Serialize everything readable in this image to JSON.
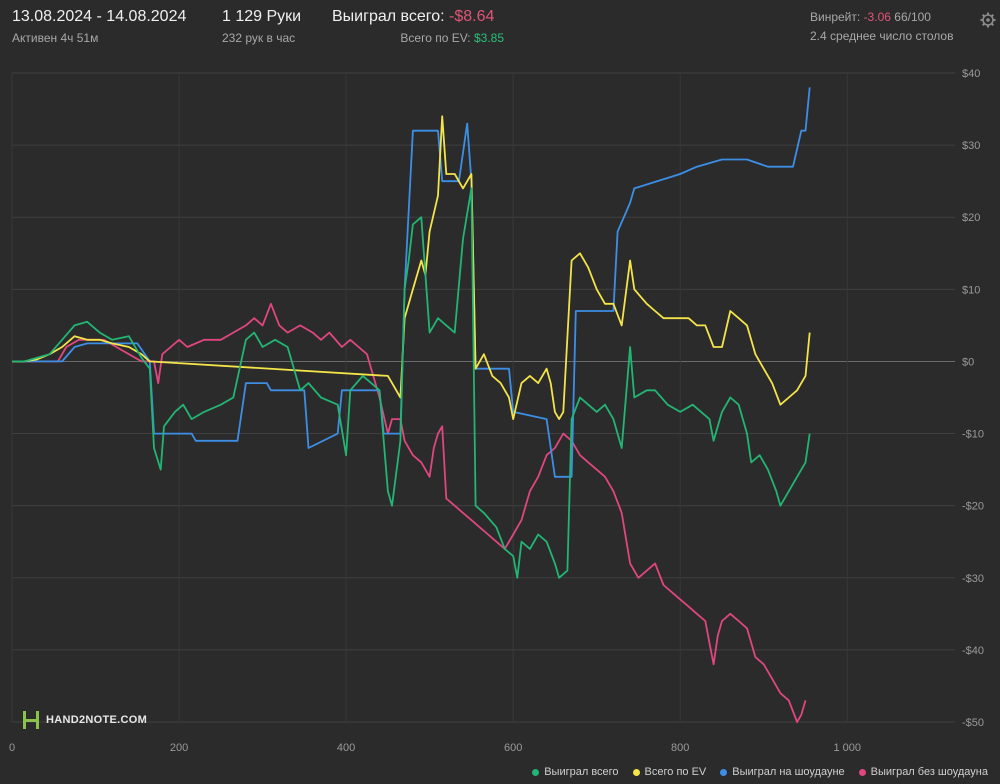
{
  "header": {
    "date_range": "13.08.2024 - 14.08.2024",
    "active": "Активен 4ч 51м",
    "hands": "1 129 Руки",
    "hands_per_hour": "232 рук в час",
    "won_total_label": "Выиграл всего:",
    "won_total_value": "-$8.64",
    "ev_label": "Всего по EV:",
    "ev_value": "$3.85",
    "winrate_label": "Винрейт:",
    "winrate_value": "-3.06",
    "winrate_suffix": "66/100",
    "avg_tables": "2.4 среднее число столов"
  },
  "logo": {
    "text": "HAND2NOTE.COM"
  },
  "colors": {
    "background": "#2b2b2b",
    "grid": "#3f3f3f",
    "green": "#22b573",
    "yellow": "#f4e44a",
    "blue": "#3d8fe6",
    "pink": "#e0467f"
  },
  "chart_data": {
    "type": "line",
    "xlim": [
      0,
      1129
    ],
    "ylim": [
      -50,
      40
    ],
    "x_ticks": [
      {
        "value": 0,
        "label": "0"
      },
      {
        "value": 200,
        "label": "200"
      },
      {
        "value": 400,
        "label": "400"
      },
      {
        "value": 600,
        "label": "600"
      },
      {
        "value": 800,
        "label": "800"
      },
      {
        "value": 1000,
        "label": "1 000"
      }
    ],
    "y_ticks": [
      {
        "value": 40,
        "label": "$40"
      },
      {
        "value": 30,
        "label": "$30"
      },
      {
        "value": 20,
        "label": "$20"
      },
      {
        "value": 10,
        "label": "$10"
      },
      {
        "value": 0,
        "label": "$0"
      },
      {
        "value": -10,
        "label": "-$10"
      },
      {
        "value": -20,
        "label": "-$20"
      },
      {
        "value": -30,
        "label": "-$30"
      },
      {
        "value": -40,
        "label": "-$40"
      },
      {
        "value": -50,
        "label": "-$50"
      }
    ],
    "grid": true,
    "legend_position": "bottom-right",
    "series": [
      {
        "name": "Выиграл всего",
        "color": "#22b573",
        "points": [
          [
            0,
            0
          ],
          [
            15,
            0
          ],
          [
            30,
            0.5
          ],
          [
            45,
            1
          ],
          [
            60,
            3
          ],
          [
            75,
            5
          ],
          [
            90,
            5.5
          ],
          [
            105,
            4
          ],
          [
            120,
            3
          ],
          [
            140,
            3.5
          ],
          [
            155,
            0.5
          ],
          [
            165,
            -1
          ],
          [
            170,
            -12
          ],
          [
            178,
            -15
          ],
          [
            182,
            -9
          ],
          [
            195,
            -7
          ],
          [
            205,
            -6
          ],
          [
            215,
            -8
          ],
          [
            230,
            -7
          ],
          [
            250,
            -6
          ],
          [
            265,
            -5
          ],
          [
            280,
            3
          ],
          [
            290,
            4
          ],
          [
            300,
            2
          ],
          [
            315,
            3
          ],
          [
            330,
            2
          ],
          [
            345,
            -4
          ],
          [
            355,
            -3
          ],
          [
            370,
            -5
          ],
          [
            390,
            -6
          ],
          [
            400,
            -13
          ],
          [
            405,
            -4
          ],
          [
            420,
            -2
          ],
          [
            430,
            -3
          ],
          [
            440,
            -4
          ],
          [
            450,
            -18
          ],
          [
            455,
            -20
          ],
          [
            465,
            -11
          ],
          [
            470,
            10
          ],
          [
            475,
            14
          ],
          [
            480,
            19
          ],
          [
            490,
            20
          ],
          [
            500,
            4
          ],
          [
            505,
            5
          ],
          [
            510,
            6
          ],
          [
            520,
            5
          ],
          [
            530,
            4
          ],
          [
            540,
            17
          ],
          [
            550,
            24
          ],
          [
            555,
            -20
          ],
          [
            565,
            -21
          ],
          [
            580,
            -23
          ],
          [
            590,
            -26
          ],
          [
            600,
            -27
          ],
          [
            605,
            -30
          ],
          [
            610,
            -25
          ],
          [
            620,
            -26
          ],
          [
            630,
            -24
          ],
          [
            640,
            -25
          ],
          [
            650,
            -28
          ],
          [
            655,
            -30
          ],
          [
            665,
            -29
          ],
          [
            670,
            -8
          ],
          [
            680,
            -5
          ],
          [
            690,
            -6
          ],
          [
            700,
            -7
          ],
          [
            710,
            -6
          ],
          [
            720,
            -8
          ],
          [
            730,
            -12
          ],
          [
            735,
            -5
          ],
          [
            740,
            2
          ],
          [
            745,
            -5
          ],
          [
            760,
            -4
          ],
          [
            770,
            -4
          ],
          [
            785,
            -6
          ],
          [
            800,
            -7
          ],
          [
            815,
            -6
          ],
          [
            825,
            -7
          ],
          [
            835,
            -8
          ],
          [
            840,
            -11
          ],
          [
            850,
            -7
          ],
          [
            860,
            -5
          ],
          [
            870,
            -6
          ],
          [
            880,
            -10
          ],
          [
            885,
            -14
          ],
          [
            895,
            -13
          ],
          [
            905,
            -15
          ],
          [
            915,
            -18
          ],
          [
            920,
            -20
          ],
          [
            930,
            -18
          ],
          [
            940,
            -16
          ],
          [
            950,
            -14
          ],
          [
            955,
            -10
          ]
        ]
      },
      {
        "name": "Всего по EV",
        "color": "#f4e44a",
        "points": [
          [
            0,
            0
          ],
          [
            15,
            0
          ],
          [
            30,
            0.3
          ],
          [
            45,
            1
          ],
          [
            60,
            2
          ],
          [
            75,
            3.5
          ],
          [
            90,
            3
          ],
          [
            105,
            3
          ],
          [
            120,
            2.5
          ],
          [
            140,
            2
          ],
          [
            155,
            1
          ],
          [
            165,
            0
          ],
          [
            450,
            -2
          ],
          [
            465,
            -5
          ],
          [
            470,
            6
          ],
          [
            480,
            10
          ],
          [
            490,
            14
          ],
          [
            495,
            12
          ],
          [
            500,
            18
          ],
          [
            510,
            23
          ],
          [
            515,
            34
          ],
          [
            520,
            26
          ],
          [
            530,
            26
          ],
          [
            540,
            24
          ],
          [
            550,
            26
          ],
          [
            555,
            -1
          ],
          [
            565,
            1
          ],
          [
            575,
            -2
          ],
          [
            585,
            -3
          ],
          [
            595,
            -5
          ],
          [
            600,
            -8
          ],
          [
            610,
            -3
          ],
          [
            620,
            -2
          ],
          [
            630,
            -3
          ],
          [
            640,
            -1
          ],
          [
            645,
            -3
          ],
          [
            650,
            -7
          ],
          [
            655,
            -8
          ],
          [
            660,
            -7
          ],
          [
            670,
            14
          ],
          [
            680,
            15
          ],
          [
            690,
            13
          ],
          [
            700,
            10
          ],
          [
            710,
            8
          ],
          [
            720,
            8
          ],
          [
            730,
            5
          ],
          [
            740,
            14
          ],
          [
            745,
            10
          ],
          [
            760,
            8
          ],
          [
            770,
            7
          ],
          [
            780,
            6
          ],
          [
            800,
            6
          ],
          [
            810,
            6
          ],
          [
            820,
            5
          ],
          [
            830,
            5
          ],
          [
            840,
            2
          ],
          [
            850,
            2
          ],
          [
            860,
            7
          ],
          [
            870,
            6
          ],
          [
            880,
            5
          ],
          [
            890,
            1
          ],
          [
            900,
            -1
          ],
          [
            910,
            -3
          ],
          [
            920,
            -6
          ],
          [
            930,
            -5
          ],
          [
            940,
            -4
          ],
          [
            950,
            -2
          ],
          [
            955,
            4
          ]
        ]
      },
      {
        "name": "Выиграл на шоудауне",
        "color": "#3d8fe6",
        "points": [
          [
            0,
            0
          ],
          [
            60,
            0
          ],
          [
            75,
            2
          ],
          [
            90,
            2.5
          ],
          [
            150,
            2.5
          ],
          [
            165,
            0
          ],
          [
            170,
            -10
          ],
          [
            215,
            -10
          ],
          [
            220,
            -11
          ],
          [
            270,
            -11
          ],
          [
            275,
            -7
          ],
          [
            280,
            -3
          ],
          [
            305,
            -3
          ],
          [
            310,
            -4
          ],
          [
            350,
            -4
          ],
          [
            355,
            -12
          ],
          [
            390,
            -10
          ],
          [
            395,
            -4
          ],
          [
            440,
            -4
          ],
          [
            445,
            -10
          ],
          [
            465,
            -10
          ],
          [
            470,
            10
          ],
          [
            480,
            32
          ],
          [
            510,
            32
          ],
          [
            515,
            25
          ],
          [
            535,
            25
          ],
          [
            545,
            33
          ],
          [
            550,
            25
          ],
          [
            555,
            -1
          ],
          [
            595,
            -1
          ],
          [
            600,
            -7
          ],
          [
            640,
            -8
          ],
          [
            650,
            -16
          ],
          [
            670,
            -16
          ],
          [
            675,
            7
          ],
          [
            720,
            7
          ],
          [
            725,
            18
          ],
          [
            740,
            22
          ],
          [
            745,
            24
          ],
          [
            800,
            26
          ],
          [
            820,
            27
          ],
          [
            850,
            28
          ],
          [
            880,
            28
          ],
          [
            905,
            27
          ],
          [
            935,
            27
          ],
          [
            945,
            32
          ],
          [
            950,
            32
          ],
          [
            955,
            38
          ]
        ]
      },
      {
        "name": "Выиграл без шоудауна",
        "color": "#e0467f",
        "points": [
          [
            0,
            0
          ],
          [
            40,
            0
          ],
          [
            55,
            0
          ],
          [
            65,
            2
          ],
          [
            80,
            3
          ],
          [
            95,
            3
          ],
          [
            110,
            3
          ],
          [
            125,
            2
          ],
          [
            140,
            1
          ],
          [
            155,
            0
          ],
          [
            170,
            0
          ],
          [
            175,
            -3
          ],
          [
            180,
            1
          ],
          [
            190,
            2
          ],
          [
            200,
            3
          ],
          [
            210,
            2
          ],
          [
            230,
            3
          ],
          [
            250,
            3
          ],
          [
            265,
            4
          ],
          [
            280,
            5
          ],
          [
            290,
            6
          ],
          [
            300,
            5
          ],
          [
            310,
            8
          ],
          [
            320,
            5
          ],
          [
            330,
            4
          ],
          [
            345,
            5
          ],
          [
            360,
            4
          ],
          [
            370,
            3
          ],
          [
            380,
            4
          ],
          [
            395,
            2
          ],
          [
            405,
            3
          ],
          [
            415,
            2
          ],
          [
            425,
            1
          ],
          [
            430,
            -1
          ],
          [
            440,
            -5
          ],
          [
            450,
            -10
          ],
          [
            455,
            -8
          ],
          [
            465,
            -8
          ],
          [
            470,
            -11
          ],
          [
            480,
            -13
          ],
          [
            490,
            -14
          ],
          [
            500,
            -16
          ],
          [
            505,
            -12
          ],
          [
            510,
            -10
          ],
          [
            515,
            -9
          ],
          [
            520,
            -19
          ],
          [
            530,
            -20
          ],
          [
            540,
            -21
          ],
          [
            550,
            -22
          ],
          [
            560,
            -23
          ],
          [
            570,
            -24
          ],
          [
            580,
            -25
          ],
          [
            590,
            -26
          ],
          [
            600,
            -24
          ],
          [
            610,
            -22
          ],
          [
            620,
            -18
          ],
          [
            630,
            -16
          ],
          [
            640,
            -13
          ],
          [
            650,
            -12
          ],
          [
            660,
            -10
          ],
          [
            670,
            -11
          ],
          [
            680,
            -13
          ],
          [
            690,
            -14
          ],
          [
            700,
            -15
          ],
          [
            710,
            -16
          ],
          [
            720,
            -18
          ],
          [
            730,
            -21
          ],
          [
            740,
            -28
          ],
          [
            750,
            -30
          ],
          [
            760,
            -29
          ],
          [
            770,
            -28
          ],
          [
            780,
            -31
          ],
          [
            790,
            -32
          ],
          [
            800,
            -33
          ],
          [
            810,
            -34
          ],
          [
            820,
            -35
          ],
          [
            830,
            -36
          ],
          [
            835,
            -39
          ],
          [
            840,
            -42
          ],
          [
            845,
            -38
          ],
          [
            850,
            -36
          ],
          [
            860,
            -35
          ],
          [
            870,
            -36
          ],
          [
            880,
            -37
          ],
          [
            890,
            -41
          ],
          [
            900,
            -42
          ],
          [
            910,
            -44
          ],
          [
            920,
            -46
          ],
          [
            930,
            -47
          ],
          [
            940,
            -50
          ],
          [
            945,
            -49
          ],
          [
            950,
            -47
          ]
        ]
      }
    ]
  }
}
